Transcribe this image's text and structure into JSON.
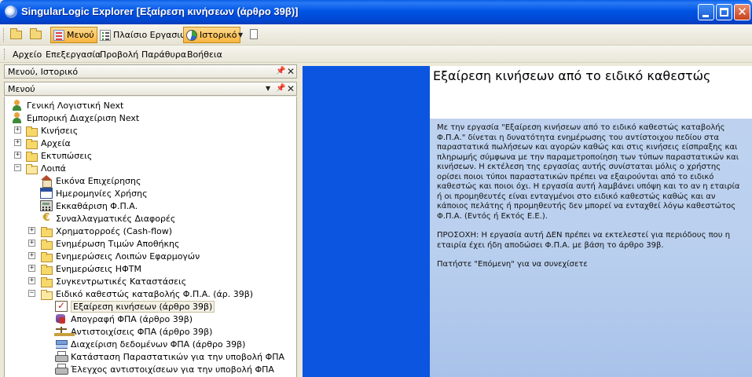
{
  "window": {
    "title": "SingularLogic Explorer [Εξαίρεση κινήσεων (άρθρο 39β)]",
    "controls": [
      "minimize",
      "maximize",
      "close"
    ]
  },
  "toolbar": {
    "menu_label": "Μενού",
    "tasks_label": "Πλαίσιο Εργασιών",
    "history_label": "Ιστορικό"
  },
  "menubar": {
    "items": [
      "Αρχείο",
      "Επεξεργασία",
      "Προβολή",
      "Παράθυρα",
      "Βοήθεια"
    ]
  },
  "outer_panel": {
    "title": "Μενού, Ιστορικό"
  },
  "inner_panel": {
    "title": "Μενού"
  },
  "tree": {
    "items": [
      {
        "label": "Γενική Λογιστική Next",
        "icon": "user-icon"
      },
      {
        "label": "Εμπορική Διαχείριση Next",
        "icon": "user-icon"
      },
      {
        "label": "Κινήσεις",
        "icon": "folder-icon",
        "expander": "+"
      },
      {
        "label": "Αρχεία",
        "icon": "folder-icon",
        "expander": "+"
      },
      {
        "label": "Εκτυπώσεις",
        "icon": "folder-icon",
        "expander": "+"
      },
      {
        "label": "Λοιπά",
        "icon": "folder-open-icon",
        "expander": "-"
      },
      {
        "label": "Εικόνα Επιχείρησης",
        "icon": "house-icon"
      },
      {
        "label": "Ημερομηνίες Χρήσης",
        "icon": "calendar-icon"
      },
      {
        "label": "Εκκαθάριση Φ.Π.Α.",
        "icon": "calculator-icon"
      },
      {
        "label": "Συναλλαγματικές Διαφορές",
        "icon": "euro-icon"
      },
      {
        "label": "Χρηματορροές (Cash-flow)",
        "icon": "folder-icon",
        "expander": "+"
      },
      {
        "label": "Ενημέρωση Τιμών Αποθήκης",
        "icon": "folder-icon",
        "expander": "+"
      },
      {
        "label": "Ενημερώσεις Λοιπών Εφαρμογών",
        "icon": "folder-icon",
        "expander": "+"
      },
      {
        "label": "Ενημερώσεις ΗΦΤΜ",
        "icon": "folder-icon",
        "expander": "+"
      },
      {
        "label": "Συγκεντρωτικές Καταστάσεις",
        "icon": "folder-icon",
        "expander": "+"
      },
      {
        "label": "Ειδικό καθεστώς καταβολής Φ.Π.Α. (άρ. 39β)",
        "icon": "folder-open-icon",
        "expander": "-"
      },
      {
        "label": "Εξαίρεση κινήσεων (άρθρο 39β)",
        "icon": "checklist-icon",
        "selected": true
      },
      {
        "label": "Απογραφή ΦΠΑ (άρθρο 39β)",
        "icon": "database-icon"
      },
      {
        "label": "Αντιστοιχίσεις ΦΠΑ (άρθρο 39β)",
        "icon": "scale-icon"
      },
      {
        "label": "Διαχείριση δεδομένων ΦΠΑ (άρθρο 39β)",
        "icon": "stack-icon"
      },
      {
        "label": "Κατάσταση Παραστατικών για την υποβολή ΦΠΑ",
        "icon": "printer-icon"
      },
      {
        "label": "Έλεγχος αντιστοιχίσεων για την υποβολή ΦΠΑ",
        "icon": "printer-icon"
      }
    ]
  },
  "document": {
    "title": "Εξαίρεση κινήσεων από το ειδικό καθεστώς",
    "paragraphs": [
      "Με την εργασία \"Εξαίρεση κινήσεων από το ειδικό καθεστώς καταβολής Φ.Π.Α.\" δίνεται η δυνατότητα ενημέρωσης του αντίστοιχου πεδίου στα παραστατικά πωλήσεων και αγορών καθώς και στις κινήσεις είσπραξης και πληρωμής σύμφωνα με την παραμετροποίηση των τύπων παραστατικών και κινήσεων. Η εκτέλεση της εργασίας αυτής συνίσταται μόλις ο χρήστης ορίσει ποιοι τύποι παραστατικών πρέπει να εξαιρούνται από το ειδικό καθεστώς και ποιοι όχι. Η εργασία αυτή λαμβάνει υπόψη και το αν η εταιρία ή οι προμηθευτές είναι ενταγμένοι στο ειδικό καθεστώς καθώς και αν κάποιος πελάτης ή προμηθευτής δεν μπορεί να ενταχθεί λόγω καθεστώτος Φ.Π.Α. (Εντός ή Εκτός Ε.Ε.).",
      "ΠΡΟΣΟΧΗ: Η εργασία αυτή ΔΕΝ πρέπει να εκτελεστεί για περιόδους που η εταιρία έχει ήδη αποδώσει Φ.Π.Α. με βάση το άρθρο 39β.",
      "Πατήστε \"Επόμενη\" για να συνεχίσετε"
    ]
  },
  "colors": {
    "titlebar": "#0055e5",
    "doc_left": "#0b55e1",
    "doc_right": "#b9cfee",
    "toolbar_active": "#f7b540"
  }
}
